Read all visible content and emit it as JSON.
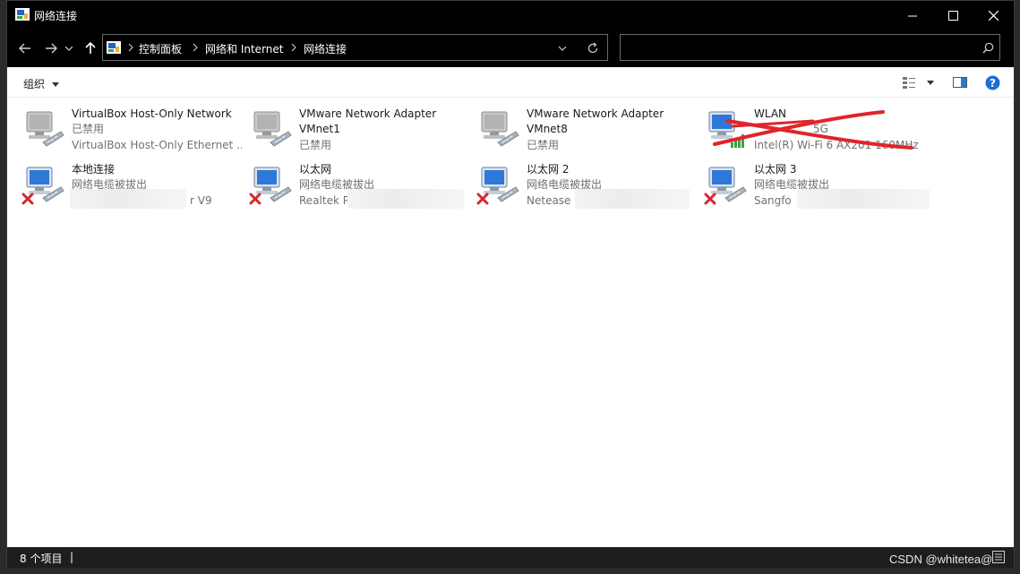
{
  "window": {
    "title": "网络连接",
    "minimize_glyph": "—",
    "maximize_glyph": "☐",
    "close_glyph": "✕"
  },
  "nav": {
    "breadcrumb": [
      "控制面板",
      "网络和 Internet",
      "网络连接"
    ],
    "search_placeholder": ""
  },
  "toolbar": {
    "organize_label": "组织"
  },
  "connections": [
    {
      "name": "VirtualBox Host-Only Network",
      "name2": "",
      "status": "已禁用",
      "device": "VirtualBox Host-Only Ethernet ...",
      "state": "disabled"
    },
    {
      "name": "VMware Network Adapter",
      "name2": "VMnet1",
      "status": "已禁用",
      "device": "",
      "state": "disabled"
    },
    {
      "name": "VMware Network Adapter",
      "name2": "VMnet8",
      "status": "已禁用",
      "device": "",
      "state": "disabled"
    },
    {
      "name": "WLAN",
      "name2": "",
      "status": "5G",
      "device": "Intel(R) Wi-Fi 6 AX201 160MHz",
      "state": "wifi"
    },
    {
      "name": "本地连接",
      "name2": "",
      "status": "网络电缆被拔出",
      "device": "r V9",
      "state": "unplugged"
    },
    {
      "name": "以太网",
      "name2": "",
      "status": "网络电缆被拔出",
      "device": "Realtek P",
      "state": "unplugged"
    },
    {
      "name": "以太网 2",
      "name2": "",
      "status": "网络电缆被拔出",
      "device": "Netease",
      "state": "unplugged"
    },
    {
      "name": "以太网 3",
      "name2": "",
      "status": "网络电缆被拔出",
      "device": "Sangfo",
      "state": "unplugged"
    }
  ],
  "statusbar": {
    "count": "8 个项目",
    "separator": "|"
  },
  "watermark": "CSDN @whitetea@",
  "colors": {
    "accent": "#0067c0",
    "error_red": "#d6262b",
    "scribble_red": "#e0242b",
    "help_blue": "#1c6fd1"
  }
}
